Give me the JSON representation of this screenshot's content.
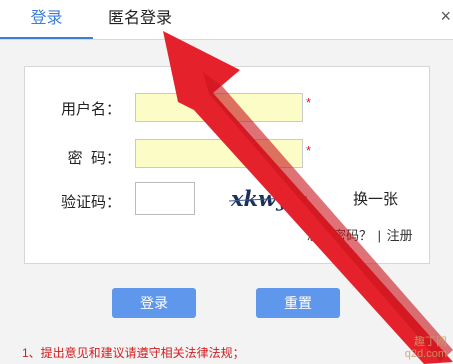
{
  "tabs": [
    {
      "label": "登录",
      "active": true
    },
    {
      "label": "匿名登录",
      "active": false
    }
  ],
  "close_icon": "×",
  "form": {
    "username_label": "用户名：",
    "password_label": "密  码：",
    "captcha_label": "验证码：",
    "required_mark": "*",
    "username_value": "",
    "password_value": "",
    "captcha_value": "",
    "captcha_text": "xkwy",
    "refresh_label": "换一张",
    "forgot_label": "忘记密码？",
    "separator": "|",
    "register_label": "注册"
  },
  "buttons": {
    "login_label": "登录",
    "reset_label": "重置"
  },
  "notice": "1、提出意见和建议请遵守相关法律法规；",
  "watermark": {
    "line1": "趣丁网",
    "line2": "q2d.com"
  },
  "colors": {
    "accent": "#3d7fd8",
    "button": "#5e97ec",
    "input_fill": "#fbfcc6",
    "arrow": "#e5222c",
    "notice": "#d02020"
  }
}
